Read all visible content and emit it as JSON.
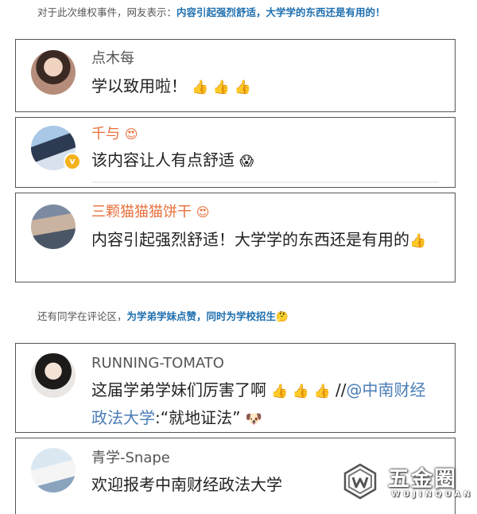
{
  "caption1": {
    "prefix": "对于此次维权事件，网友表示：",
    "highlight": "内容引起强烈舒适，大学学的东西还是有用的！"
  },
  "comments_group1": [
    {
      "username": "点木每",
      "text": "学以致用啦！",
      "thumbs": "👍 👍 👍"
    },
    {
      "username": "千与",
      "name_emoji": "😍",
      "verified_badge": "v",
      "text": "该内容让人有点舒适",
      "text_emoji": "😱"
    },
    {
      "username": "三颗猫猫猫饼干",
      "name_emoji": "😍",
      "text": "内容引起强烈舒适！大学学的东西还是有用的",
      "thumbs": "👍"
    }
  ],
  "caption2": {
    "prefix": "还有同学在评论区，",
    "highlight": "为学弟学妹点赞，同时为学校招生",
    "emoji": "🤔"
  },
  "comments_group2": [
    {
      "username": "RUNNING-TOMATO",
      "text_before": "这届学弟学妹们厉害了啊",
      "thumbs": "👍 👍 👍",
      "slashes": "//",
      "link": "@中南财经政法大学",
      "text_after": ":“就地证法”",
      "text_emoji": "🐶"
    },
    {
      "username": "青学-Snape",
      "text": "欢迎报考中南财经政法大学"
    }
  ],
  "watermark": {
    "title": "五金圈",
    "subtitle": "WUJINQUAN",
    "logo_icon": "wujinquan-logo-icon"
  },
  "colors": {
    "highlight": "#1e6fb0",
    "orange_name": "#e8703c",
    "link": "#4a7cb5",
    "badge": "#f4b21e"
  }
}
